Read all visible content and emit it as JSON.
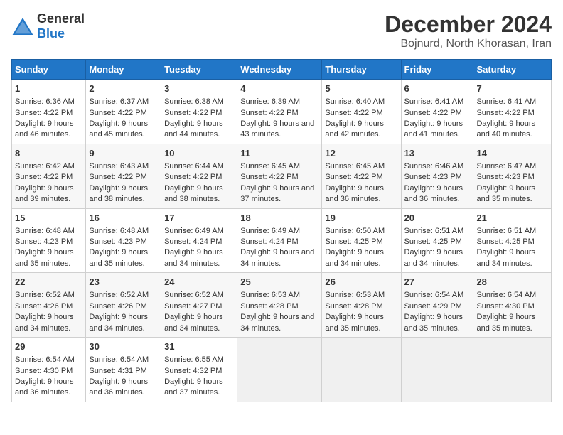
{
  "logo": {
    "general": "General",
    "blue": "Blue"
  },
  "title": "December 2024",
  "subtitle": "Bojnurd, North Khorasan, Iran",
  "days_header": [
    "Sunday",
    "Monday",
    "Tuesday",
    "Wednesday",
    "Thursday",
    "Friday",
    "Saturday"
  ],
  "weeks": [
    [
      {
        "day": "1",
        "sunrise": "6:36 AM",
        "sunset": "4:22 PM",
        "daylight": "9 hours and 46 minutes."
      },
      {
        "day": "2",
        "sunrise": "6:37 AM",
        "sunset": "4:22 PM",
        "daylight": "9 hours and 45 minutes."
      },
      {
        "day": "3",
        "sunrise": "6:38 AM",
        "sunset": "4:22 PM",
        "daylight": "9 hours and 44 minutes."
      },
      {
        "day": "4",
        "sunrise": "6:39 AM",
        "sunset": "4:22 PM",
        "daylight": "9 hours and 43 minutes."
      },
      {
        "day": "5",
        "sunrise": "6:40 AM",
        "sunset": "4:22 PM",
        "daylight": "9 hours and 42 minutes."
      },
      {
        "day": "6",
        "sunrise": "6:41 AM",
        "sunset": "4:22 PM",
        "daylight": "9 hours and 41 minutes."
      },
      {
        "day": "7",
        "sunrise": "6:41 AM",
        "sunset": "4:22 PM",
        "daylight": "9 hours and 40 minutes."
      }
    ],
    [
      {
        "day": "8",
        "sunrise": "6:42 AM",
        "sunset": "4:22 PM",
        "daylight": "9 hours and 39 minutes."
      },
      {
        "day": "9",
        "sunrise": "6:43 AM",
        "sunset": "4:22 PM",
        "daylight": "9 hours and 38 minutes."
      },
      {
        "day": "10",
        "sunrise": "6:44 AM",
        "sunset": "4:22 PM",
        "daylight": "9 hours and 38 minutes."
      },
      {
        "day": "11",
        "sunrise": "6:45 AM",
        "sunset": "4:22 PM",
        "daylight": "9 hours and 37 minutes."
      },
      {
        "day": "12",
        "sunrise": "6:45 AM",
        "sunset": "4:22 PM",
        "daylight": "9 hours and 36 minutes."
      },
      {
        "day": "13",
        "sunrise": "6:46 AM",
        "sunset": "4:23 PM",
        "daylight": "9 hours and 36 minutes."
      },
      {
        "day": "14",
        "sunrise": "6:47 AM",
        "sunset": "4:23 PM",
        "daylight": "9 hours and 35 minutes."
      }
    ],
    [
      {
        "day": "15",
        "sunrise": "6:48 AM",
        "sunset": "4:23 PM",
        "daylight": "9 hours and 35 minutes."
      },
      {
        "day": "16",
        "sunrise": "6:48 AM",
        "sunset": "4:23 PM",
        "daylight": "9 hours and 35 minutes."
      },
      {
        "day": "17",
        "sunrise": "6:49 AM",
        "sunset": "4:24 PM",
        "daylight": "9 hours and 34 minutes."
      },
      {
        "day": "18",
        "sunrise": "6:49 AM",
        "sunset": "4:24 PM",
        "daylight": "9 hours and 34 minutes."
      },
      {
        "day": "19",
        "sunrise": "6:50 AM",
        "sunset": "4:25 PM",
        "daylight": "9 hours and 34 minutes."
      },
      {
        "day": "20",
        "sunrise": "6:51 AM",
        "sunset": "4:25 PM",
        "daylight": "9 hours and 34 minutes."
      },
      {
        "day": "21",
        "sunrise": "6:51 AM",
        "sunset": "4:25 PM",
        "daylight": "9 hours and 34 minutes."
      }
    ],
    [
      {
        "day": "22",
        "sunrise": "6:52 AM",
        "sunset": "4:26 PM",
        "daylight": "9 hours and 34 minutes."
      },
      {
        "day": "23",
        "sunrise": "6:52 AM",
        "sunset": "4:26 PM",
        "daylight": "9 hours and 34 minutes."
      },
      {
        "day": "24",
        "sunrise": "6:52 AM",
        "sunset": "4:27 PM",
        "daylight": "9 hours and 34 minutes."
      },
      {
        "day": "25",
        "sunrise": "6:53 AM",
        "sunset": "4:28 PM",
        "daylight": "9 hours and 34 minutes."
      },
      {
        "day": "26",
        "sunrise": "6:53 AM",
        "sunset": "4:28 PM",
        "daylight": "9 hours and 35 minutes."
      },
      {
        "day": "27",
        "sunrise": "6:54 AM",
        "sunset": "4:29 PM",
        "daylight": "9 hours and 35 minutes."
      },
      {
        "day": "28",
        "sunrise": "6:54 AM",
        "sunset": "4:30 PM",
        "daylight": "9 hours and 35 minutes."
      }
    ],
    [
      {
        "day": "29",
        "sunrise": "6:54 AM",
        "sunset": "4:30 PM",
        "daylight": "9 hours and 36 minutes."
      },
      {
        "day": "30",
        "sunrise": "6:54 AM",
        "sunset": "4:31 PM",
        "daylight": "9 hours and 36 minutes."
      },
      {
        "day": "31",
        "sunrise": "6:55 AM",
        "sunset": "4:32 PM",
        "daylight": "9 hours and 37 minutes."
      },
      null,
      null,
      null,
      null
    ]
  ]
}
